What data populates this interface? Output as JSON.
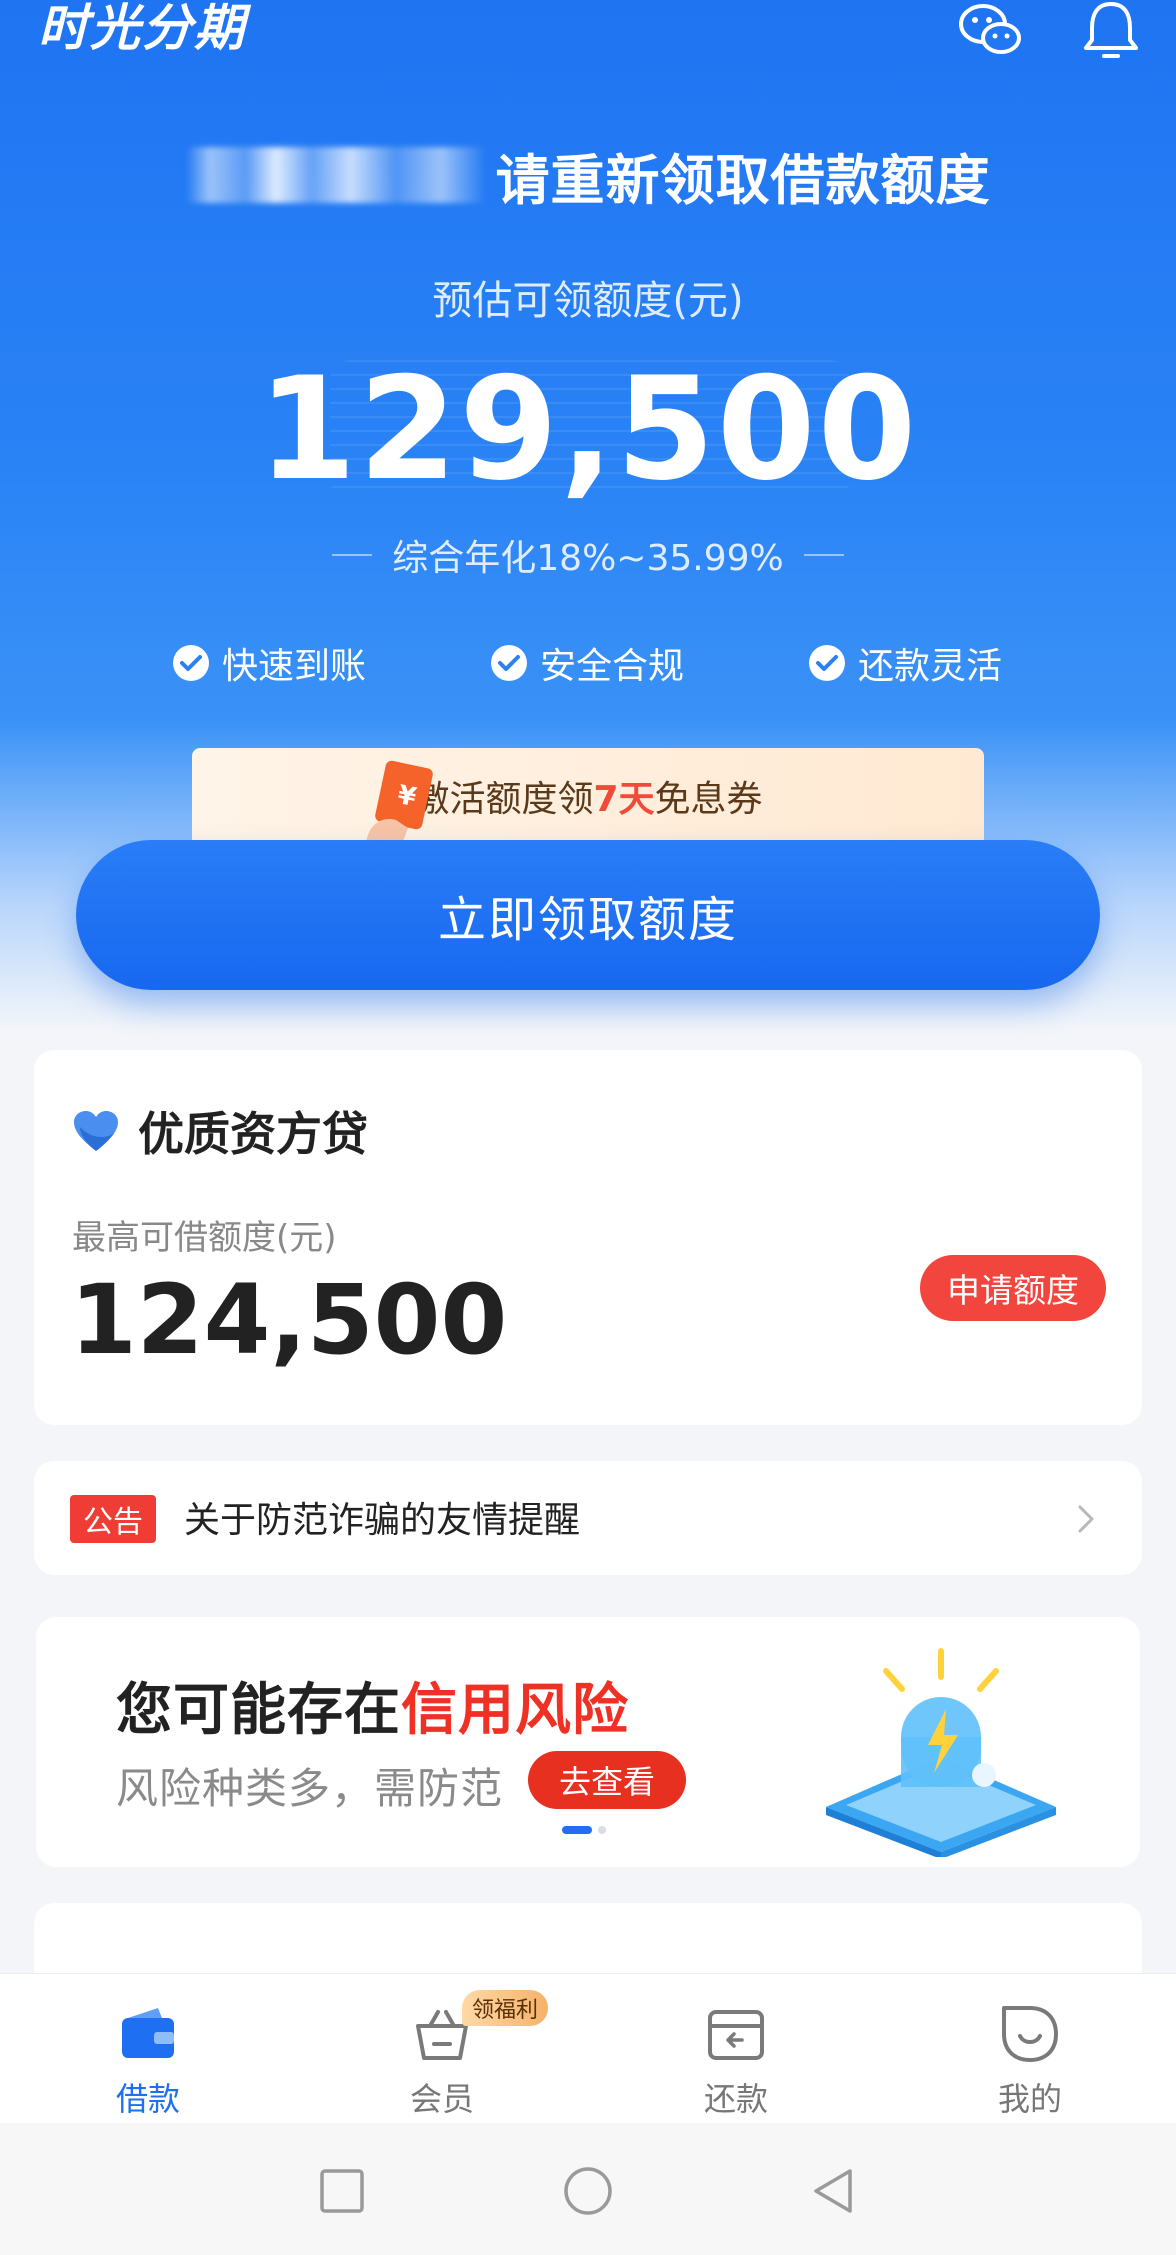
{
  "app": {
    "logo": "时光分期"
  },
  "header": {
    "masked_name": "",
    "headline": "请重新领取借款额度",
    "quota_label": "预估可领额度(元)",
    "quota_amount": "129,500",
    "rate_text": "综合年化18%~35.99%",
    "features": [
      "快速到账",
      "安全合规",
      "还款灵活"
    ]
  },
  "coupon": {
    "text_before": "激活额度领",
    "highlight": "7天",
    "text_after": "免息券"
  },
  "claim_button": {
    "label": "立即领取额度"
  },
  "loan_card": {
    "title": "优质资方贷",
    "subtitle": "最高可借额度(元)",
    "amount": "124,500",
    "apply_label": "申请额度"
  },
  "notice": {
    "badge": "公告",
    "text": "关于防范诈骗的友情提醒"
  },
  "risk_banner": {
    "title_prefix": "您可能存在",
    "title_highlight": "信用风险",
    "subtitle": "风险种类多，需防范",
    "button_label": "去查看"
  },
  "tabbar": {
    "items": [
      {
        "label": "借款",
        "icon": "wallet-icon",
        "active": true
      },
      {
        "label": "会员",
        "icon": "basket-icon",
        "badge": "领福利"
      },
      {
        "label": "还款",
        "icon": "repay-card-icon"
      },
      {
        "label": "我的",
        "icon": "smile-icon"
      }
    ]
  },
  "colors": {
    "primary": "#1e6ff2",
    "danger": "#ef3025",
    "coupon_bg": "#ffe9d2"
  }
}
